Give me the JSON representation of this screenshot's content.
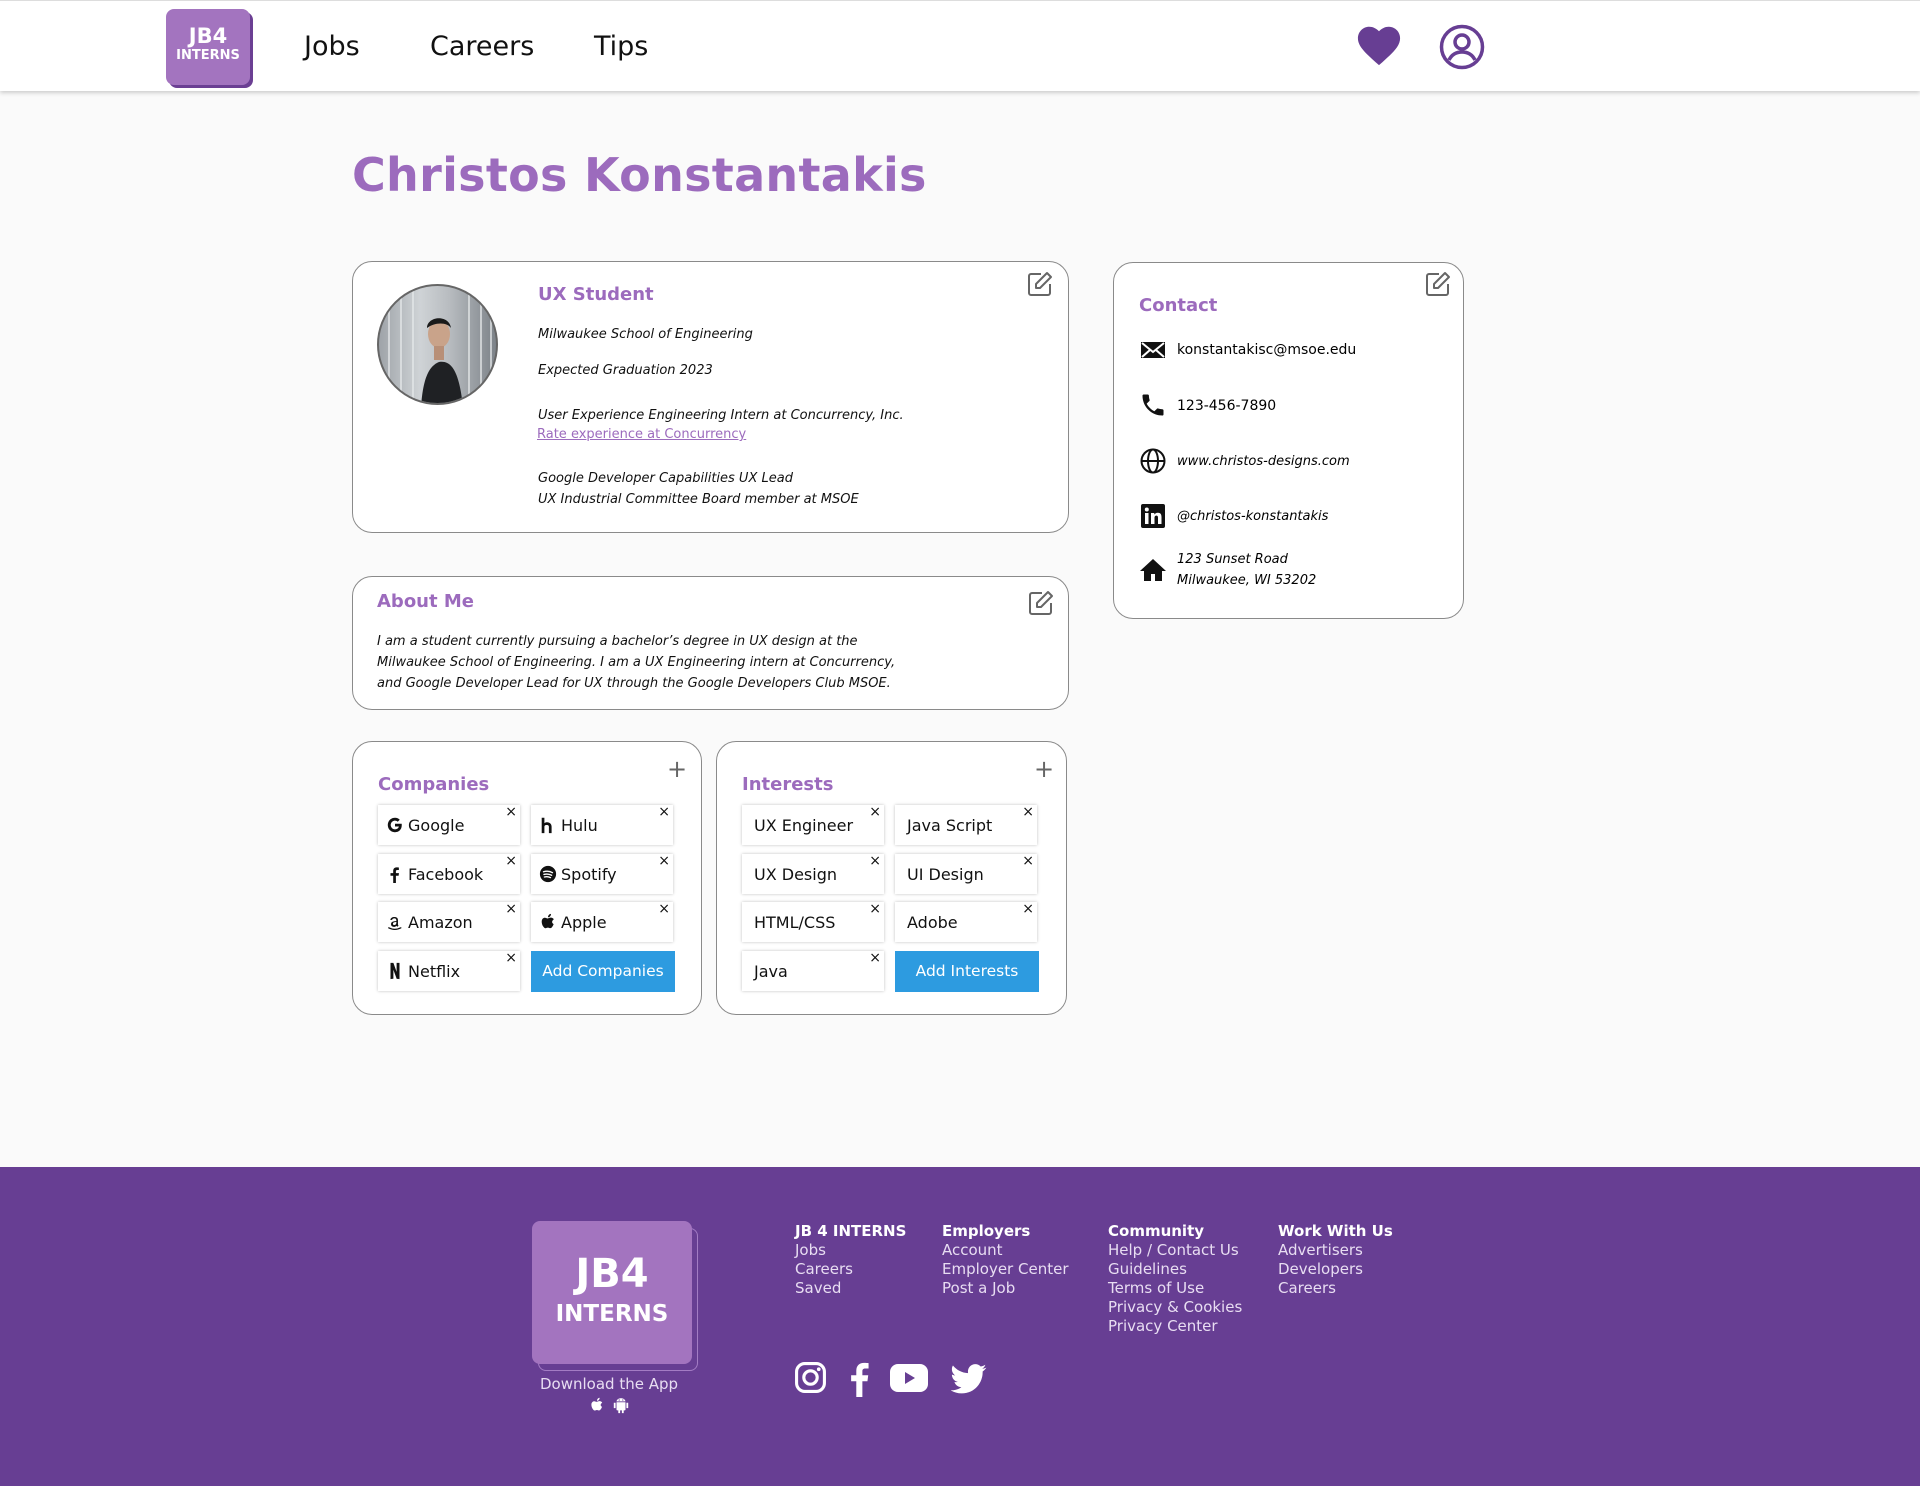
{
  "header": {
    "logo_line1": "JB4",
    "logo_line2": "INTERNS",
    "nav": [
      "Jobs",
      "Careers",
      "Tips"
    ]
  },
  "profile": {
    "name": "Christos Konstantakis",
    "role": "UX Student",
    "school": "Milwaukee School of Engineering",
    "graduation": "Expected Graduation 2023",
    "internship": "User Experience Engineering Intern at Concurrency, Inc.",
    "rate_link": "Rate experience at Concurrency",
    "position1": "Google Developer Capabilities UX Lead",
    "position2": "UX Industrial Committee Board member at MSOE"
  },
  "about": {
    "title": "About Me",
    "lines": [
      "I am a student currently pursuing a bachelor’s degree in UX design at the",
      "Milwaukee School of Engineering. I am a UX Engineering intern at Concurrency,",
      "and Google Developer Lead for UX through the Google Developers Club MSOE."
    ]
  },
  "contact": {
    "title": "Contact",
    "email": "konstantakisc@msoe.edu",
    "phone": "123-456-7890",
    "website": "www.christos-designs.com",
    "linkedin": "@christos-konstantakis",
    "address_line1": "123 Sunset Road",
    "address_line2": "Milwaukee, WI 53202"
  },
  "companies": {
    "title": "Companies",
    "items": [
      "Google",
      "Hulu",
      "Facebook",
      "Spotify",
      "Amazon",
      "Apple",
      "Netflix"
    ],
    "add_label": "Add Companies"
  },
  "interests": {
    "title": "Interests",
    "items": [
      "UX Engineer",
      "Java Script",
      "UX Design",
      "UI Design",
      "HTML/CSS",
      "Adobe",
      "Java"
    ],
    "add_label": "Add Interests"
  },
  "footer": {
    "logo_line1": "JB4",
    "logo_line2": "INTERNS",
    "download": "Download the App",
    "columns": [
      {
        "heading": "JB 4 INTERNS",
        "items": [
          "Jobs",
          "Careers",
          "Saved"
        ]
      },
      {
        "heading": "Employers",
        "items": [
          "Account",
          "Employer Center",
          "Post a Job"
        ]
      },
      {
        "heading": "Community",
        "items": [
          "Help / Contact Us",
          "Guidelines",
          "Terms of Use",
          "Privacy & Cookies",
          "Privacy Center"
        ]
      },
      {
        "heading": "Work With Us",
        "items": [
          "Advertisers",
          "Developers",
          "Careers"
        ]
      }
    ]
  },
  "colors": {
    "brand_purple": "#9c6bbd",
    "footer_purple": "#673e93",
    "button_blue": "#2d9be0"
  }
}
